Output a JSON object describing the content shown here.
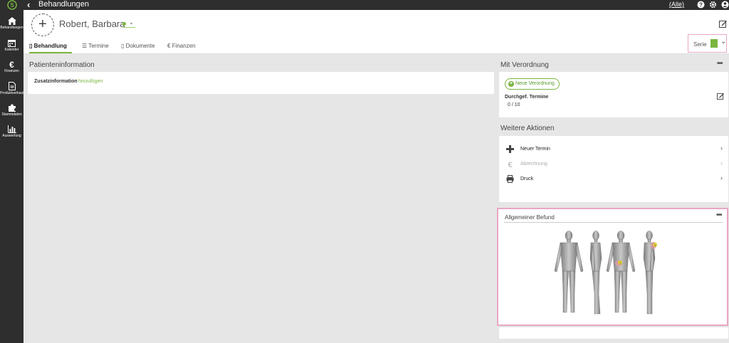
{
  "topbar": {
    "title": "Behandlungen",
    "filter": "(Alle)"
  },
  "sidebar": {
    "items": [
      {
        "label": "Behandlungen",
        "icon": "home-icon"
      },
      {
        "label": "Kalender",
        "icon": "calendar-icon"
      },
      {
        "label": "Finanzen",
        "icon": "euro-icon"
      },
      {
        "label": "Produktverkauf",
        "icon": "document-icon"
      },
      {
        "label": "Stammdaten",
        "icon": "puzzle-icon"
      },
      {
        "label": "Auswertung",
        "icon": "chart-icon"
      }
    ]
  },
  "header": {
    "patient_name": "Robert, Barbara",
    "tabs": [
      {
        "label": "Behandlung",
        "icon": "bookmark-icon"
      },
      {
        "label": "Termine",
        "icon": "list-icon"
      },
      {
        "label": "Dokumente",
        "icon": "file-icon"
      },
      {
        "label": "Finanzen",
        "icon": "euro-icon"
      }
    ],
    "serie_label": "Serie"
  },
  "patient_info": {
    "title": "Patienteninformation",
    "zusatz_label": "Zusatzinformation",
    "zusatz_link": "hinzufügen"
  },
  "verordnung": {
    "title": "Mit Verordnung",
    "new_button": "Neue Verordnung",
    "done_label": "Durchgef. Termine",
    "done_value": "0 / 10"
  },
  "actions": {
    "title": "Weitere Aktionen",
    "items": [
      {
        "label": "Neuer Termin",
        "icon": "plus-icon",
        "enabled": true
      },
      {
        "label": "Abrechnung",
        "icon": "euro-icon",
        "enabled": false
      },
      {
        "label": "Druck",
        "icon": "printer-icon",
        "enabled": true
      }
    ]
  },
  "befund": {
    "title": "Allgemeiner Befund",
    "markers": [
      "1",
      "2"
    ]
  },
  "colors": {
    "accent": "#7ab640",
    "highlight": "#e8a6c4",
    "dark": "#2e2e2e"
  }
}
